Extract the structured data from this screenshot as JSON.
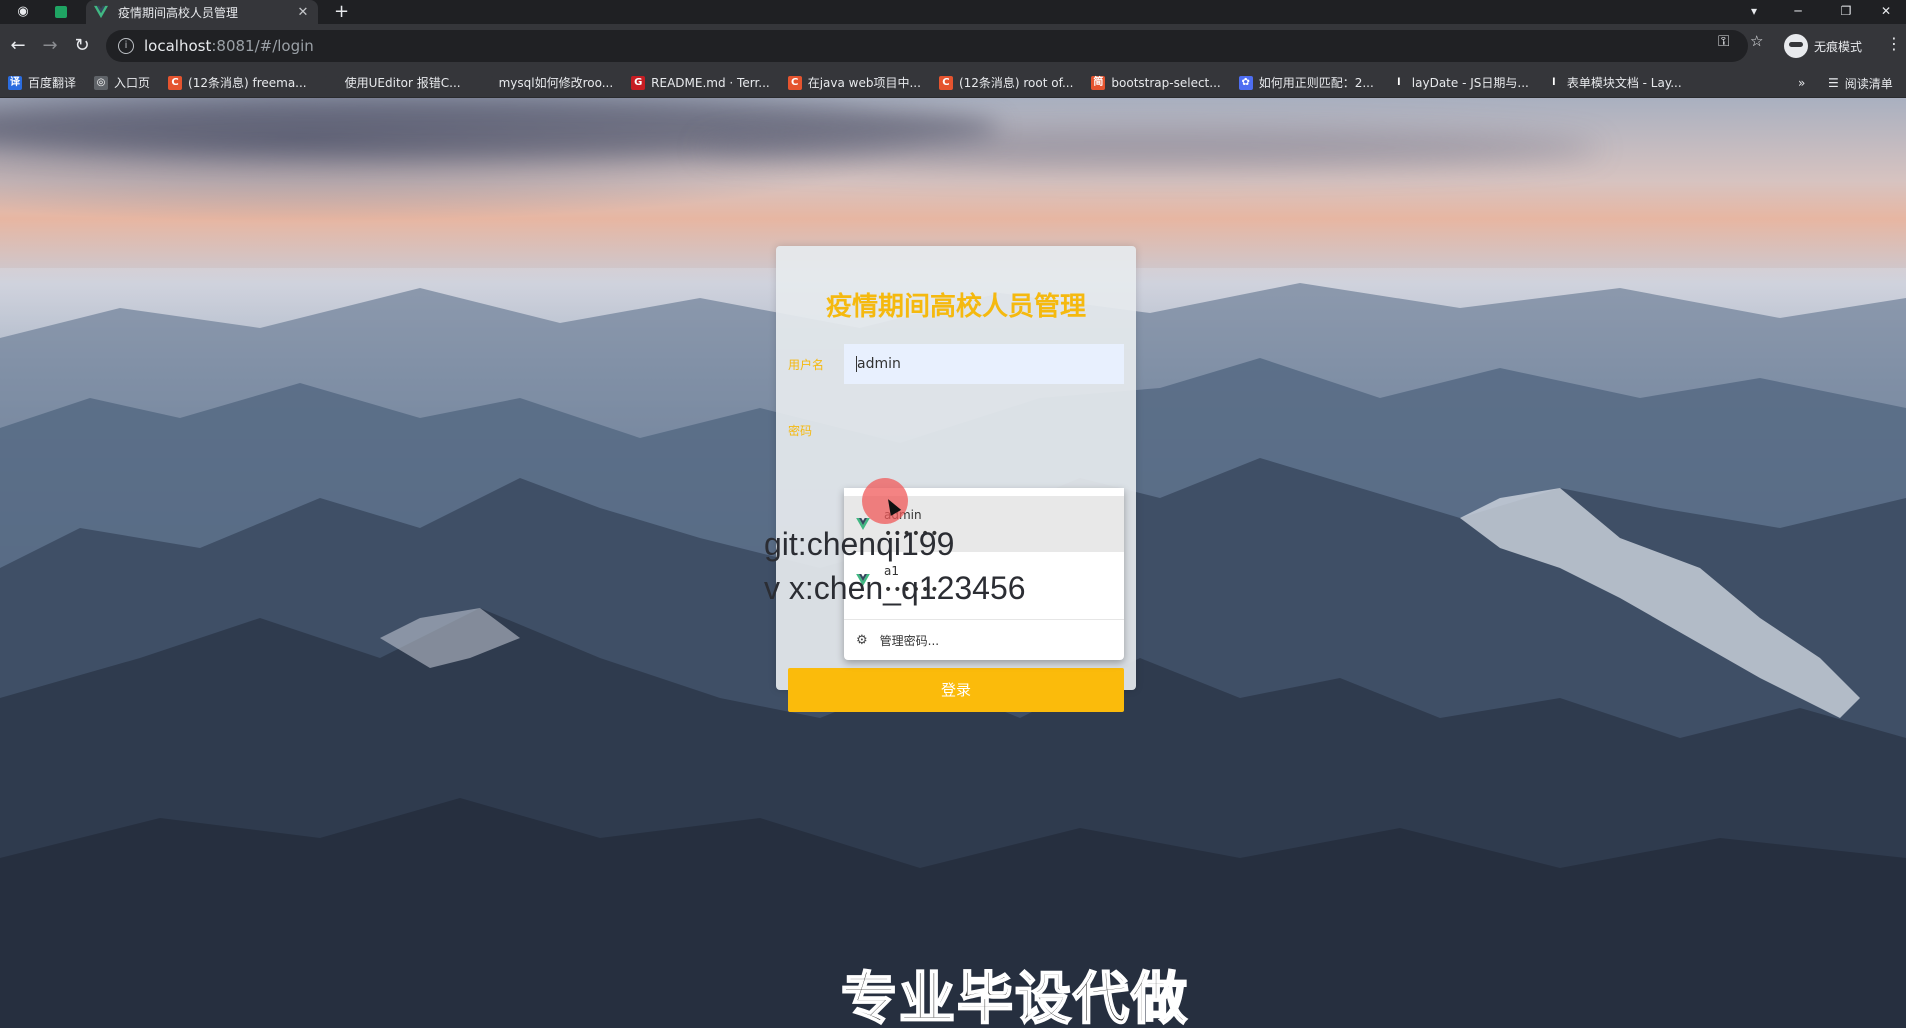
{
  "tab": {
    "title": "疫情期间高校人员管理"
  },
  "address": {
    "host": "localhost",
    "path": ":8081/#/login"
  },
  "profile": {
    "label": "无痕模式"
  },
  "bookmarks": [
    {
      "label": "百度翻译",
      "color": "#2b6de0",
      "icon": "fanyi-icon"
    },
    {
      "label": "入口页",
      "color": "#5f6368",
      "icon": "globe-icon"
    },
    {
      "label": "(12条消息) freema...",
      "color": "#e5542f",
      "icon": "csdn-icon"
    },
    {
      "label": "使用UEditor 报错C...",
      "color": "#35363a",
      "icon": "blank-icon"
    },
    {
      "label": "mysql如何修改roo...",
      "color": "#35363a",
      "icon": "blank-icon"
    },
    {
      "label": "README.md · Terr...",
      "color": "#c71d23",
      "icon": "gitee-icon"
    },
    {
      "label": "在java web项目中...",
      "color": "#e5542f",
      "icon": "csdn-icon"
    },
    {
      "label": "(12条消息) root of...",
      "color": "#e5542f",
      "icon": "csdn-icon"
    },
    {
      "label": "bootstrap-select...",
      "color": "#e5542f",
      "icon": "jianshu-icon"
    },
    {
      "label": "如何用正则匹配：2...",
      "color": "#4e6ef2",
      "icon": "baidu-icon"
    },
    {
      "label": "layDate - JS日期与...",
      "color": "#35363a",
      "icon": "layui-icon"
    },
    {
      "label": "表单模块文档 - Lay...",
      "color": "#35363a",
      "icon": "layui-icon"
    }
  ],
  "bookmarks_right": {
    "more": "»",
    "reading_list": "阅读清单"
  },
  "login": {
    "title": "疫情期间高校人员管理",
    "username_label": "用户名",
    "username_value": "admin",
    "password_label": "密码",
    "button": "登录"
  },
  "autocomplete": {
    "items": [
      {
        "name": "admin",
        "password": "••••••"
      },
      {
        "name": "a1",
        "password": "••••••"
      }
    ],
    "manage": "管理密码..."
  },
  "watermark": {
    "line1": "git:chenqi199",
    "line2": "v x:chen_q123456",
    "footer": "专业毕设代做"
  },
  "colors": {
    "accent": "#fbbb0b",
    "title": "#f5b90f"
  }
}
